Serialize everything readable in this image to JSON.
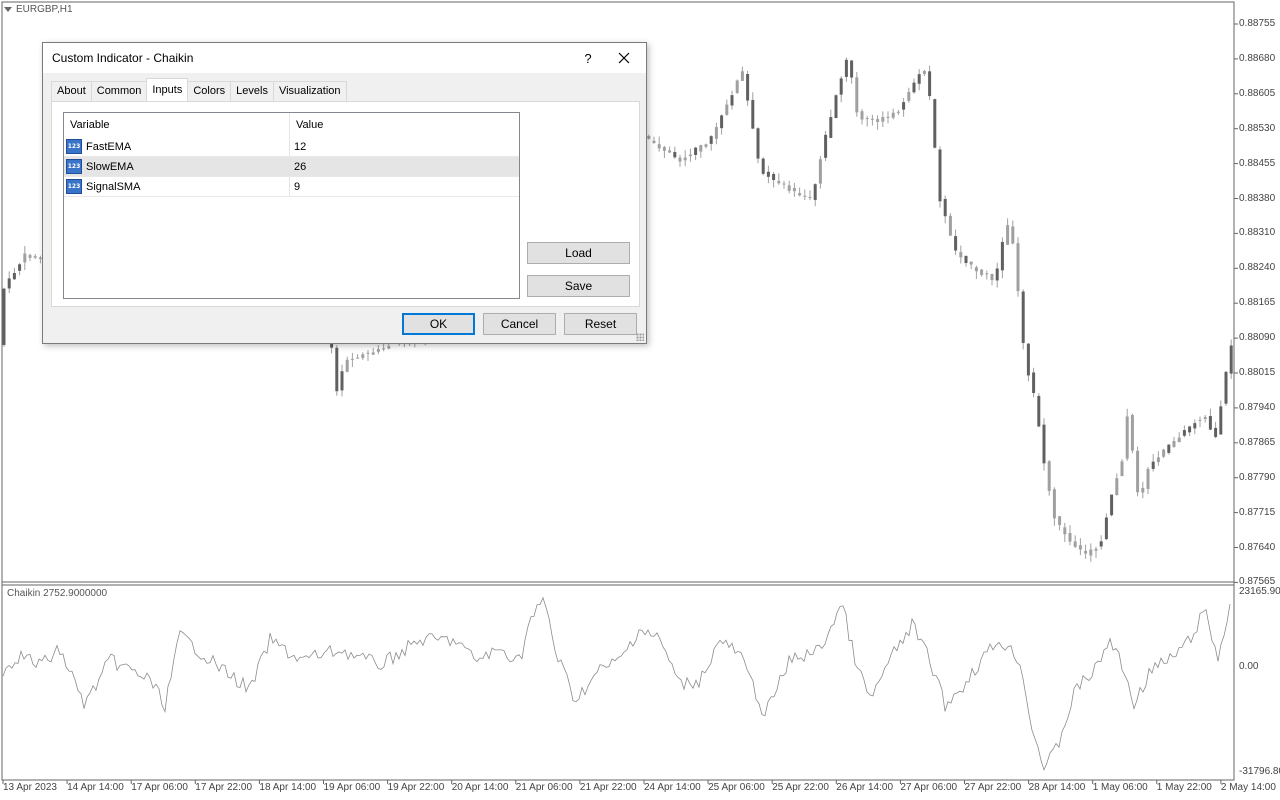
{
  "chart": {
    "symbol": "EURGBP,H1",
    "indicator_label": "Chaikin 2752.9000000",
    "price_axis": [
      "0.88755",
      "0.88680",
      "0.88605",
      "0.88530",
      "0.88455",
      "0.88380",
      "0.88310",
      "0.88240",
      "0.88165",
      "0.88090",
      "0.88015",
      "0.87940",
      "0.87865",
      "0.87790",
      "0.87715",
      "0.87640",
      "0.87565"
    ],
    "indicator_axis": [
      "23165.905",
      "0.00",
      "-31796.80"
    ],
    "time_axis": [
      "13 Apr 2023",
      "14 Apr 14:00",
      "17 Apr 06:00",
      "17 Apr 22:00",
      "18 Apr 14:00",
      "19 Apr 06:00",
      "19 Apr 22:00",
      "20 Apr 14:00",
      "21 Apr 06:00",
      "21 Apr 22:00",
      "24 Apr 14:00",
      "25 Apr 06:00",
      "25 Apr 22:00",
      "26 Apr 14:00",
      "27 Apr 06:00",
      "27 Apr 22:00",
      "28 Apr 14:00",
      "1 May 06:00",
      "1 May 22:00",
      "2 May 14:00"
    ],
    "colors": {
      "candle": "#a0a0a0",
      "candle_dark": "#606060",
      "indicator_line": "#8c8c8c",
      "separator": "#666666"
    }
  },
  "dialog": {
    "title": "Custom Indicator - Chaikin",
    "help_label": "?",
    "tabs": [
      {
        "label": "About"
      },
      {
        "label": "Common"
      },
      {
        "label": "Inputs"
      },
      {
        "label": "Colors"
      },
      {
        "label": "Levels"
      },
      {
        "label": "Visualization"
      }
    ],
    "active_tab": "Inputs",
    "grid": {
      "headers": [
        "Variable",
        "Value"
      ],
      "rows": [
        {
          "icon": "123",
          "variable": "FastEMA",
          "value": "12"
        },
        {
          "icon": "123",
          "variable": "SlowEMA",
          "value": "26"
        },
        {
          "icon": "123",
          "variable": "SignalSMA",
          "value": "9"
        }
      ]
    },
    "buttons": {
      "load": "Load",
      "save": "Save",
      "ok": "OK",
      "cancel": "Cancel",
      "reset": "Reset"
    }
  }
}
